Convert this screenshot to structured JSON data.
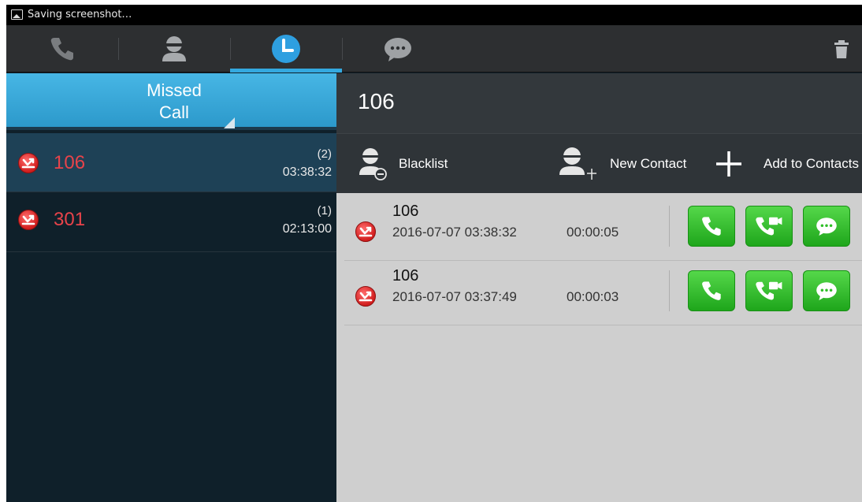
{
  "status_bar": {
    "text": "Saving screenshot…",
    "icon": "image-icon"
  },
  "tabs": [
    {
      "name": "dialer",
      "icon": "phone-icon",
      "active": false
    },
    {
      "name": "contacts",
      "icon": "person-icon",
      "active": false
    },
    {
      "name": "call-history",
      "icon": "clock-icon",
      "active": true
    },
    {
      "name": "messages",
      "icon": "chat-icon",
      "active": false
    }
  ],
  "toolbar": {
    "delete_icon": "trash-icon"
  },
  "filter": {
    "label": "Missed\nCall"
  },
  "call_list": [
    {
      "number": "106",
      "count": "(2)",
      "time": "03:38:32",
      "selected": true
    },
    {
      "number": "301",
      "count": "(1)",
      "time": "02:13:00",
      "selected": false
    }
  ],
  "detail": {
    "title": "106",
    "actions": [
      {
        "label": "Blacklist",
        "icon": "blacklist-icon"
      },
      {
        "label": "New Contact",
        "icon": "new-contact-icon"
      },
      {
        "label": "Add to Contacts",
        "icon": "plus-icon"
      }
    ],
    "log": [
      {
        "number": "106",
        "datetime": "2016-07-07 03:38:32",
        "duration": "00:00:05"
      },
      {
        "number": "106",
        "datetime": "2016-07-07 03:37:49",
        "duration": "00:00:03"
      }
    ]
  },
  "colors": {
    "accent": "#34a9e0",
    "missed": "#e8434a",
    "green_button": "#2fbf27",
    "header_dark": "#33383c"
  }
}
